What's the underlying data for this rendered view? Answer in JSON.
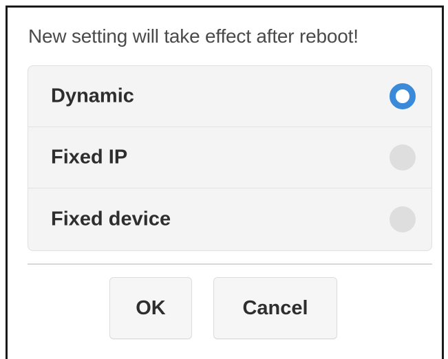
{
  "dialog": {
    "message": "New setting will take effect after reboot!",
    "options": [
      {
        "label": "Dynamic",
        "selected": true
      },
      {
        "label": "Fixed IP",
        "selected": false
      },
      {
        "label": "Fixed device",
        "selected": false
      }
    ],
    "ok_label": "OK",
    "cancel_label": "Cancel"
  },
  "colors": {
    "accent": "#3b8ad9",
    "radio_unchecked": "#dedede",
    "panel_bg": "#f4f4f4",
    "text": "#2e2e2e"
  }
}
